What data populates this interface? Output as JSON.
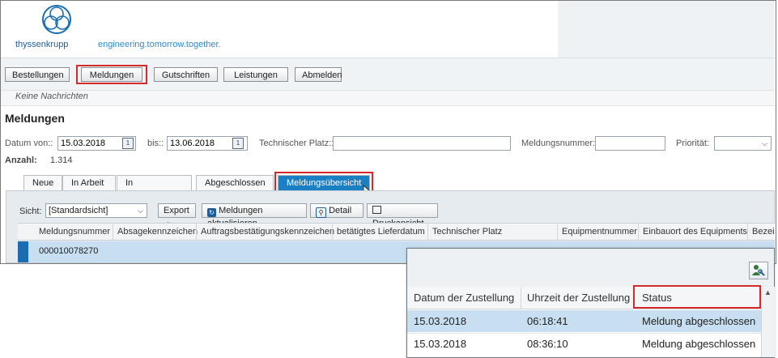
{
  "header": {
    "brand": "thyssenkrupp",
    "slogan": "engineering.tomorrow.together.",
    "colors": {
      "brand": "#1a5f9e",
      "accent": "#1b7fc4",
      "highlight": "#d62a2a"
    }
  },
  "toolbar": {
    "buttons": [
      "Bestellungen",
      "Meldungen",
      "Gutschriften",
      "Leistungen",
      "Abmelden"
    ]
  },
  "message": "Keine Nachrichten",
  "page_title": "Meldungen",
  "filters": {
    "date_from_label": "Datum von::",
    "date_from_value": "15.03.2018",
    "date_to_label": "bis::",
    "date_to_value": "13.06.2018",
    "tech_place_label": "Technischer Platz::",
    "tech_place_value": "",
    "notif_number_label": "Meldungsnummer:",
    "notif_number_value": "",
    "priority_label": "Priorität:",
    "priority_value": ""
  },
  "count": {
    "label": "Anzahl:",
    "value": "1.314"
  },
  "tabs": [
    "Neue",
    "In Arbeit",
    "In Bearbeitung",
    "Abgeschlossen",
    "Meldungsübersicht"
  ],
  "table_toolbar": {
    "view_label": "Sicht:",
    "view_value": "[Standardsicht]",
    "export_label": "Export",
    "refresh_label": "Meldungen aktualisieren",
    "detail_label": "Detail",
    "print_label": "Druckansicht"
  },
  "table": {
    "columns": [
      "Meldungsnummer",
      "Absagekennzeichen",
      "Auftragsbestätigungskennzeichen",
      "betätigtes Lieferdatum",
      "Technischer Platz",
      "Equipmentnummer",
      "Einbauort des Equipments",
      "Bezeic"
    ],
    "rows": [
      [
        "000010078270"
      ]
    ]
  },
  "popup": {
    "columns": [
      "Datum der Zustellung",
      "Uhrzeit der Zustellung",
      "Status"
    ],
    "rows": [
      [
        "15.03.2018",
        "06:18:41",
        "Meldung abgeschlossen"
      ],
      [
        "15.03.2018",
        "08:36:10",
        "Meldung abgeschlossen"
      ]
    ]
  }
}
